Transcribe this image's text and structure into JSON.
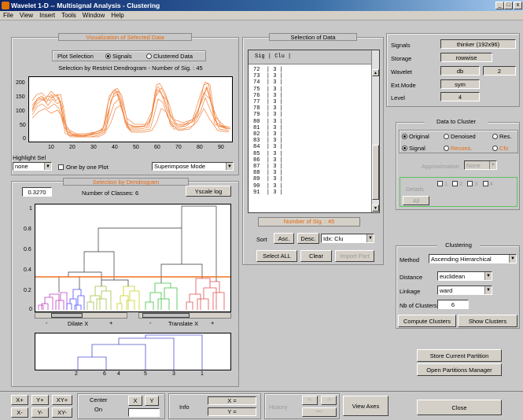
{
  "window": {
    "title": "Wavelet 1-D -- Multisignal Analysis - Clustering",
    "btn_min": "_",
    "btn_max": "□",
    "btn_close": "x"
  },
  "menu": [
    "File",
    "View",
    "Insert",
    "Tools",
    "Window",
    "Help"
  ],
  "viz": {
    "title": "Visualization of Selected Data",
    "plot_sel_label": "Plot Selection",
    "opt_signals": "Signals",
    "opt_clustered": "Clustered Data",
    "subtitle": "Selection by Restrict Dendrogram - Number of Sig. : 45",
    "yticks": [
      "200",
      "150",
      "100",
      "50",
      "0"
    ],
    "xticks": [
      "10",
      "20",
      "30",
      "40",
      "50",
      "60",
      "70",
      "80",
      "90"
    ],
    "highlight_label": "Highlight Sel",
    "highlight_value": "none",
    "one_by_one": "One by one Plot",
    "mode": "Superimpose Mode"
  },
  "dendro": {
    "title": "Selection by Dendrogram",
    "threshold": "0.3270",
    "classes": "Number of Classes: 6",
    "yscale_btn": "Yscale log",
    "yticks": [
      "1",
      "0.8",
      "0.6",
      "0.4",
      "0.2",
      "0"
    ],
    "dilate": "Dilate X",
    "translate": "Translate X",
    "minus": "-",
    "plus": "+",
    "small_xticks": [
      "2",
      "6",
      "4",
      "5",
      "3",
      "1"
    ]
  },
  "selection": {
    "title": "Selection of Data",
    "header": "Sig | Clu |",
    "rows": [
      "72  | 3 |",
      "73  | 3 |",
      "74  | 3 |",
      "75  | 3 |",
      "76  | 3 |",
      "77  | 3 |",
      "78  | 3 |",
      "79  | 3 |",
      "80  | 3 |",
      "81  | 3 |",
      "82  | 3 |",
      "83  | 3 |",
      "84  | 3 |",
      "85  | 3 |",
      "86  | 3 |",
      "87  | 3 |",
      "88  | 3 |",
      "89  | 3 |",
      "90  | 3 |",
      "91  | 3 |"
    ],
    "count": "Number of Sig. : 45",
    "sort": "Sort",
    "asc": "Asc.",
    "desc": "Desc.",
    "idx": "Idx: Clu",
    "select_all": "Select ALL",
    "clear": "Clear",
    "import": "Import Part"
  },
  "info": {
    "signals_label": "Signals",
    "signals_value": "thinker (192x96)",
    "storage_label": "Storage",
    "storage_value": "rowwise",
    "wavelet_label": "Wavelet",
    "wavelet_value": "db",
    "wavelet_n": "2",
    "extmode_label": "Ext.Mode",
    "extmode_value": "sym",
    "level_label": "Level",
    "level_value": "4"
  },
  "cluster_data": {
    "title": "Data to Cluster",
    "original": "Original",
    "denoised": "Denoised",
    "res": "Res.",
    "signal": "Signal",
    "recons": "Recons.",
    "cfs": "Cfs",
    "approx_label": "Approximation",
    "approx_value": "None",
    "details_label": "Details",
    "d1": "1",
    "d2": "2",
    "d3": "3",
    "d4": "4",
    "all": "All"
  },
  "clustering": {
    "title": "Clustering",
    "method_label": "Method",
    "method_value": "Ascending Hierarchical",
    "distance_label": "Distance",
    "distance_value": "euclidean",
    "linkage_label": "Linkage",
    "linkage_value": "ward",
    "nb_label": "Nb of Clusters",
    "nb_value": "6",
    "compute": "Compute Clusters",
    "show": "Show Clusters"
  },
  "partitions": {
    "store": "Store Current Partition",
    "open": "Open Partitions Manager"
  },
  "bottom": {
    "xp": "X+",
    "yp": "Y+",
    "xyp": "XY+",
    "xm": "X-",
    "ym": "Y-",
    "xym": "XY-",
    "center": "Center",
    "on": "On",
    "x": "X",
    "y": "Y",
    "info": "Info",
    "xeq": "X =",
    "yeq": "Y =",
    "history": "History",
    "view_axes": "View Axes",
    "close": "Close"
  },
  "colors": {
    "signal": "#f07020",
    "threshold": "#f07020",
    "accent": "#e86b10"
  }
}
